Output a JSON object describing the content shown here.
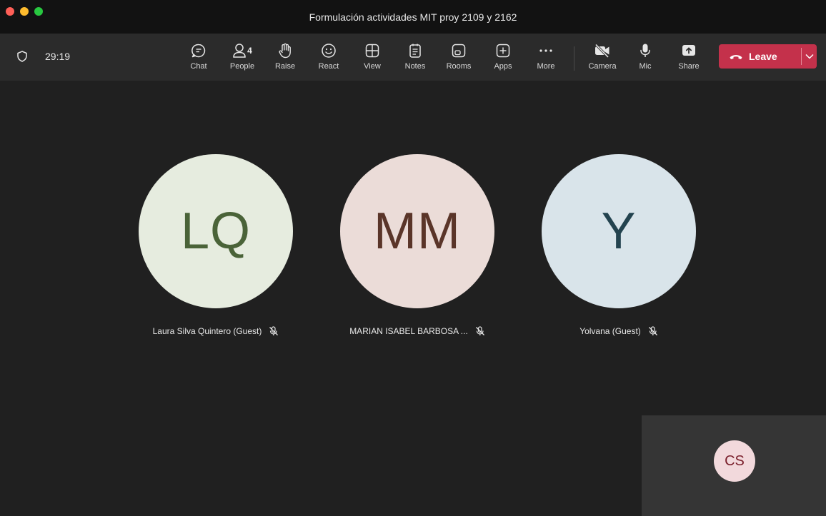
{
  "window": {
    "title": "Formulación actividades MIT proy 2109 y 2162"
  },
  "toolbar": {
    "timer": "29:19",
    "people_count": "4",
    "items": {
      "chat": "Chat",
      "people": "People",
      "raise": "Raise",
      "react": "React",
      "view": "View",
      "notes": "Notes",
      "rooms": "Rooms",
      "apps": "Apps",
      "more": "More",
      "camera": "Camera",
      "mic": "Mic",
      "share": "Share"
    },
    "leave_label": "Leave"
  },
  "participants": [
    {
      "initials": "LQ",
      "name": "Laura Silva Quintero (Guest)",
      "bg": "#e6ecdf",
      "fg": "#4a6338",
      "muted": true
    },
    {
      "initials": "MM",
      "name": "MARIAN ISABEL BARBOSA ...",
      "bg": "#ebdcd8",
      "fg": "#5a3529",
      "muted": true
    },
    {
      "initials": "Y",
      "name": "Yolvana (Guest)",
      "bg": "#d9e4ea",
      "fg": "#23434f",
      "muted": true
    }
  ],
  "self": {
    "initials": "CS"
  },
  "colors": {
    "leave": "#c4314b",
    "toolbar": "#2b2b2b",
    "stage": "#202020",
    "titlebar": "#121212"
  }
}
